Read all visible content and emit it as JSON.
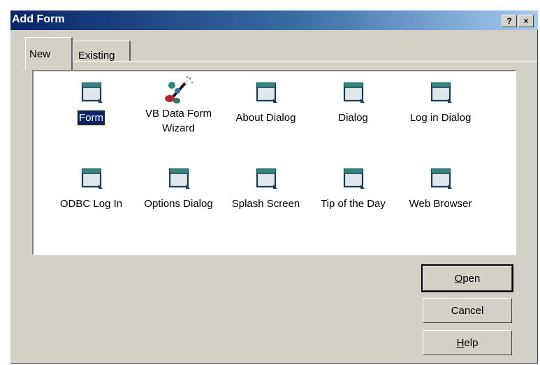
{
  "window": {
    "title": "Add Form",
    "help_glyph": "?",
    "close_glyph": "×"
  },
  "tabs": [
    {
      "label": "New"
    },
    {
      "label": "Existing"
    }
  ],
  "items": [
    {
      "label": "Form",
      "icon": "form-icon"
    },
    {
      "label": "VB Data Form Wizard",
      "line1": "VB Data Form",
      "line2": "Wizard",
      "icon": "wizard-icon"
    },
    {
      "label": "About Dialog",
      "icon": "form-icon"
    },
    {
      "label": "Dialog",
      "icon": "form-icon"
    },
    {
      "label": "Log in Dialog",
      "icon": "form-icon"
    },
    {
      "label": "ODBC Log In",
      "icon": "form-icon"
    },
    {
      "label": "Options Dialog",
      "icon": "form-icon"
    },
    {
      "label": "Splash Screen",
      "icon": "form-icon"
    },
    {
      "label": "Tip of the Day",
      "icon": "form-icon"
    },
    {
      "label": "Web Browser",
      "icon": "form-icon"
    }
  ],
  "selected_item": "Form",
  "buttons": {
    "open": {
      "label": "Open",
      "mnemonic": "O",
      "rest": "pen"
    },
    "cancel": {
      "label": "Cancel"
    },
    "help": {
      "label": "Help",
      "mnemonic": "H",
      "rest": "elp"
    }
  },
  "colors": {
    "titlebar_start": "#0a246a",
    "titlebar_end": "#a6caf0",
    "face": "#d4d0c8",
    "selection": "#0a246a"
  }
}
